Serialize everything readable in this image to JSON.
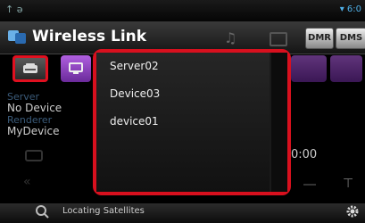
{
  "status": {
    "left_icons": "↑ ə",
    "right": "▾ 6:0"
  },
  "title": "Wireless Link",
  "title_icons": [
    "music-note-icon",
    "screen-icon"
  ],
  "buttons": {
    "dmr": "DMR",
    "dms": "DMS"
  },
  "source_buttons": [
    {
      "name": "server-button",
      "icon": "drive-icon",
      "selected": true
    },
    {
      "name": "renderer-button",
      "icon": "monitor-icon",
      "selected": false
    }
  ],
  "sidebar": {
    "server_label": "Server",
    "server_value": "No Device",
    "renderer_label": "Renderer",
    "renderer_value": "MyDevice"
  },
  "time_partial": "0:00",
  "list": {
    "items": [
      "Server02",
      "Device03",
      "device01"
    ]
  },
  "bottom": {
    "status": "Locating Satellites"
  }
}
